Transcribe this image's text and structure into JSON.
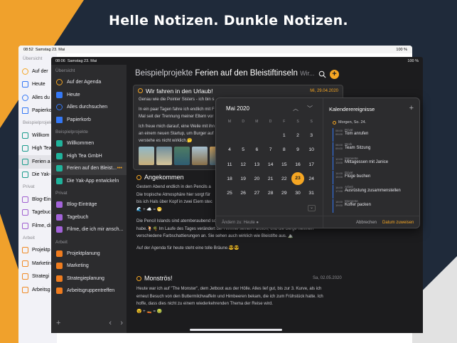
{
  "headline": "Helle Notizen. Dunkle Notizen.",
  "colors": {
    "accent": "#f5a623",
    "background": "#1f2a3a",
    "dark_panel": "#1c1c1e",
    "light_panel": "#ffffff"
  },
  "light_ipad": {
    "status_time": "08:52",
    "status_date": "Samstag 23. Mai",
    "status_right": "100 %",
    "sections": {
      "overview": "Übersicht",
      "examples": "Beispielprojekte",
      "private": "Privat",
      "work": "Arbeit"
    },
    "items": [
      "Auf der",
      "Heute",
      "Alles du",
      "Papierko",
      "Willkom",
      "High Tea",
      "Ferien a",
      "Die Yak-",
      "Blog-Ein",
      "Tagebuc",
      "Filme, di",
      "Projektp",
      "Marketin",
      "Strategi",
      "Arbeitsg"
    ]
  },
  "dark_ipad": {
    "status_time": "08:06",
    "status_date": "Samstag 23. Mai",
    "status_right": "100 %",
    "sidebar": {
      "overview_label": "Übersicht",
      "overview": [
        {
          "label": "Auf der Agenda",
          "icon": "sun-icon"
        },
        {
          "label": "Heute",
          "icon": "calendar-icon"
        },
        {
          "label": "Alles durchsuchen",
          "icon": "search-icon"
        },
        {
          "label": "Papierkorb",
          "icon": "trash-icon"
        }
      ],
      "examples_label": "Beispielprojekte",
      "examples": [
        {
          "label": "Willkommen"
        },
        {
          "label": "High Tea GmbH"
        },
        {
          "label": "Ferien auf den Bleist..."
        },
        {
          "label": "Die Yak-App entwickeln"
        }
      ],
      "private_label": "Privat",
      "private": [
        {
          "label": "Blog-Einträge"
        },
        {
          "label": "Tagebuch"
        },
        {
          "label": "Filme, die ich mir ansch..."
        }
      ],
      "work_label": "Arbeit",
      "work": [
        {
          "label": "Projektplanung"
        },
        {
          "label": "Marketing"
        },
        {
          "label": "Strategieplanung"
        },
        {
          "label": "Arbeitsgruppentreffen"
        }
      ],
      "more_dots": "•••",
      "add": "+",
      "back": "‹",
      "forward": "›"
    },
    "title": {
      "project": "Beispielprojekte",
      "page": "Ferien auf den Bleistiftinseln",
      "suffix": "Wir..."
    },
    "note1": {
      "title": "Wir fahren in den Urlaub!",
      "date": "Mi, 29.04.2020",
      "lines": [
        "Genau wie die Pointer Sisters - ich bin s",
        "In ein paar Tagen fahre ich endlich mit F",
        "Mal seit der Trennung meiner Eltern vor",
        "Ich freue mich darauf, eine Weile mit ihn",
        "an einem neuen Startup, um Burger auf",
        "verstehe es nicht wirklich.🤔"
      ]
    },
    "note2": {
      "title": "Angekommen",
      "lines": [
        "Gestern Abend endlich in den Pencils a",
        "Die tropische Atmosphäre hier sorgt für",
        "bis ich Hals über Kopf in zwei Eiern stec",
        "🌊 + ☁️ = 😁",
        "",
        "Die Pencil Islands sind atemberaubend schön, auch wenn ich mich nur bis zum Pool gewagt",
        "habe.🍹🌴  Im Laufe des Tages verändert der Himmel seinen Farbton, und die Berge nehmen",
        "verschiedene Farbschattierungen an. Sie sehen auch wirklich wie Bleistifte aus. ⛰️",
        "",
        "Auf der Agenda für heute steht eine tolle Bräune.😎😎"
      ]
    },
    "note3": {
      "title": "Monströs!",
      "date": "Sa, 02.05.2020",
      "lines": [
        "Heute war ich auf \"The Monster\", dem Jetboot aus der Hölle. Alles lief gut, bis zur 3. Kurve, als ich",
        "erneut Besuch von den Buttermilchwaffeln und Himbeeren bekam, die ich zum Frühstück hatte. Ich",
        "hoffe, dass dies nicht zu einem wiederkehrenden Thema der Reise wird.",
        "😵 + 🚤 = 🤢"
      ]
    },
    "popover": {
      "month": "Mai 2020",
      "weekdays": [
        "M",
        "D",
        "M",
        "D",
        "F",
        "S",
        "S"
      ],
      "weeks": [
        [
          "",
          "",
          "",
          "",
          "1",
          "2",
          "3"
        ],
        [
          "4",
          "5",
          "6",
          "7",
          "8",
          "9",
          "10"
        ],
        [
          "11",
          "12",
          "13",
          "14",
          "15",
          "16",
          "17"
        ],
        [
          "18",
          "19",
          "20",
          "21",
          "22",
          "23",
          "24"
        ],
        [
          "25",
          "26",
          "27",
          "28",
          "29",
          "30",
          "31"
        ]
      ],
      "selected_day": "23",
      "footer_left": "Ändern zu: Heute",
      "events_title": "Kalenderereignisse",
      "events_day": "Morgen, So. 24.",
      "events": [
        {
          "time1": "08:00",
          "time2": "09:00",
          "category": "Privat",
          "name": "Tom anrufen"
        },
        {
          "time1": "08:00",
          "time2": "09:00",
          "category": "Work",
          "name": "Team Sitzung"
        },
        {
          "time1": "12:00",
          "time2": "13:00",
          "category": "Momente",
          "name": "Mittagessen mit Janice"
        },
        {
          "time1": "14:00",
          "time2": "15:00",
          "category": "Privat",
          "name": "Flüge buchen"
        },
        {
          "time1": "16:00",
          "time2": "17:00",
          "category": "Arbeit",
          "name": "Ausrüstung zusammenstellen"
        },
        {
          "time1": "18:00",
          "time2": "19:00",
          "category": "Momente",
          "name": "Koffer packen"
        }
      ],
      "cancel": "Abbrechen",
      "accept": "Datum zuweisen"
    }
  }
}
